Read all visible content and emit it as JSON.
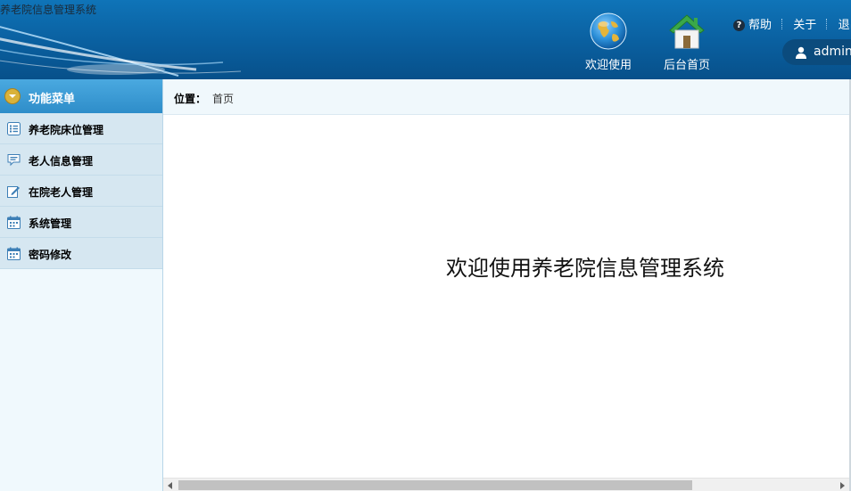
{
  "header": {
    "site_title": "养老院信息管理系统",
    "nav": [
      {
        "label": "欢迎使用",
        "icon": "globe-icon"
      },
      {
        "label": "后台首页",
        "icon": "house-icon"
      }
    ],
    "links": {
      "help": "帮助",
      "about": "关于",
      "logout": "退出"
    },
    "user": "admin"
  },
  "sidebar": {
    "title": "功能菜单",
    "items": [
      {
        "label": "养老院床位管理",
        "icon": "list-icon"
      },
      {
        "label": "老人信息管理",
        "icon": "message-icon"
      },
      {
        "label": "在院老人管理",
        "icon": "edit-icon"
      },
      {
        "label": "系统管理",
        "icon": "calendar-icon"
      },
      {
        "label": "密码修改",
        "icon": "calendar-icon"
      }
    ]
  },
  "main": {
    "breadcrumb_label": "位置：",
    "breadcrumb_item": "首页",
    "welcome": "欢迎使用养老院信息管理系统"
  },
  "colors": {
    "header_bg": "#0a5f9f",
    "sidebar_header_bg": "#3a9bd6",
    "menu_item_bg": "#d6e7f1",
    "breadcrumb_bg": "#f0f8fc"
  }
}
